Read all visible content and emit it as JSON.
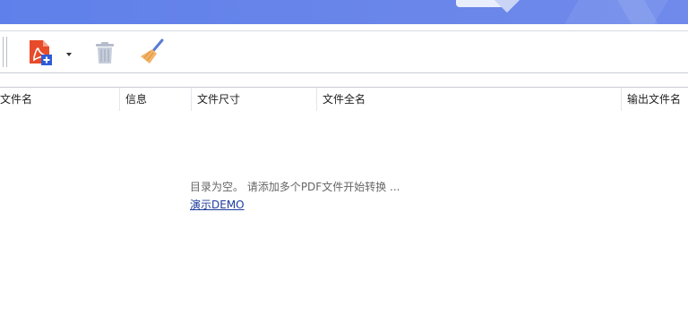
{
  "toolbar": {
    "add_pdf_icon": "pdf-add-icon",
    "dropdown_icon": "caret-down-icon",
    "delete_icon": "trash-icon",
    "clear_icon": "broom-icon"
  },
  "columns": [
    {
      "label": "文件名"
    },
    {
      "label": "信息"
    },
    {
      "label": "文件尺寸"
    },
    {
      "label": "文件全名"
    },
    {
      "label": "输出文件名"
    }
  ],
  "empty_state": {
    "message": "目录为空。 请添加多个PDF文件开始转换 ...",
    "demo_link": "演示DEMO"
  },
  "colors": {
    "header_blue": "#6a86ea",
    "pdf_red": "#e84b2a",
    "link_blue": "#1f3b9c"
  }
}
